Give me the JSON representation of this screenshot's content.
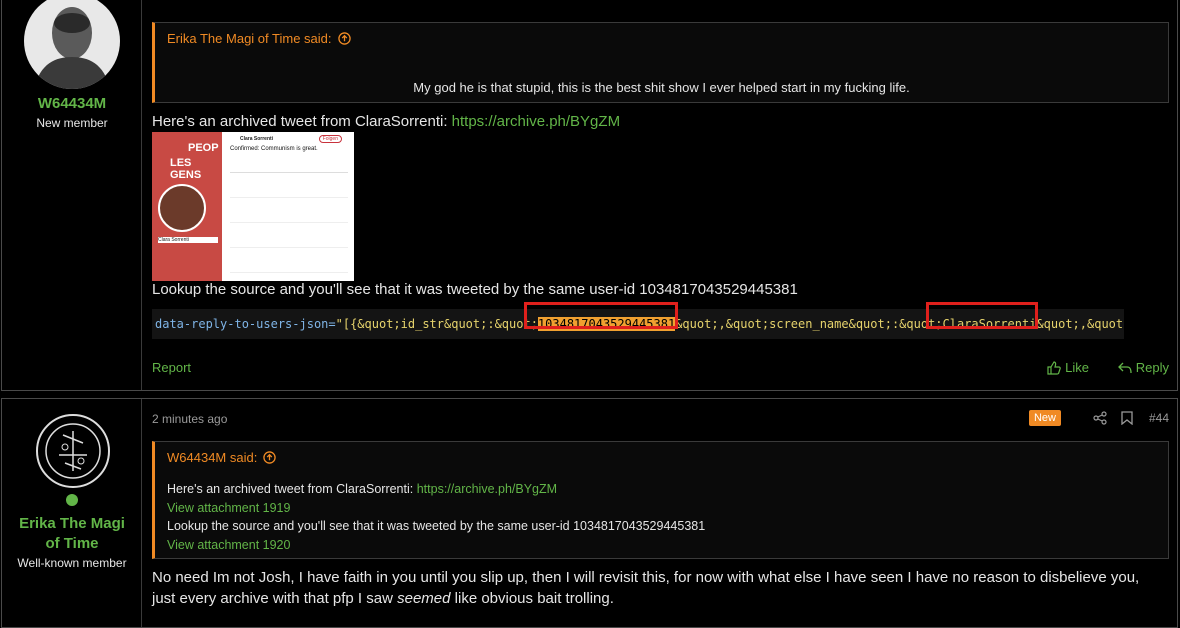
{
  "posts": [
    {
      "user": {
        "name": "W64434M",
        "title": "New member"
      },
      "quote": {
        "author_label": "Erika The Magi of Time said:",
        "text": "My god he is that stupid, this is the best shit show I ever helped start in my fucking life."
      },
      "body": {
        "intro": "Here's an archived tweet from ClaraSorrenti: ",
        "link": "https://archive.ph/BYgZM",
        "lookup": "Lookup the source and you'll see that it was tweeted by the same user-id 1034817043529445381"
      },
      "embedded_image": {
        "profile_name": "Clara Sorrenti",
        "follow_label": "Folgen",
        "tweet_text": "Confirmed: Communism is great.",
        "banner_text_1": "PEOP",
        "banner_text_2": "LES GENS",
        "side_name": "Clara Sorrenti"
      },
      "code": {
        "attr": "data-reply-to-users-json=",
        "prefix": "\"[{&quot;id_str&quot;:&quot;",
        "id": "1034817043529445381",
        "mid": "&quot;,&quot;screen_name&quot;:&quot;",
        "name": "ClaraSorrenti",
        "suffix": "&quot;,&quot;n"
      },
      "actions": {
        "report": "Report",
        "like": "Like",
        "reply": "Reply"
      }
    },
    {
      "user": {
        "name_line1": "Erika The Magi",
        "name_line2": "of Time",
        "title": "Well-known member"
      },
      "meta": {
        "time": "2 minutes ago",
        "badge": "New",
        "number": "#44"
      },
      "quote": {
        "author_label": "W64434M said:",
        "line1_text": "Here's an archived tweet from ClaraSorrenti: ",
        "line1_link": "https://archive.ph/BYgZM",
        "attachment1": "View attachment 1919",
        "line2": "Lookup the source and you'll see that it was tweeted by the same user-id 1034817043529445381",
        "attachment2": "View attachment 1920"
      },
      "body": {
        "text_a": "No need Im not Josh, I have faith in you until you slip up, then I will revisit this, for now with what else I have seen I have no reason to disbelieve you, just every archive with that pfp I saw ",
        "emph": "seemed",
        "text_b": " like obvious bait trolling."
      }
    }
  ],
  "colors": {
    "accent": "#f08a24",
    "link": "#62b548",
    "highlight": "#f0a030",
    "redbox": "#e0201c"
  }
}
